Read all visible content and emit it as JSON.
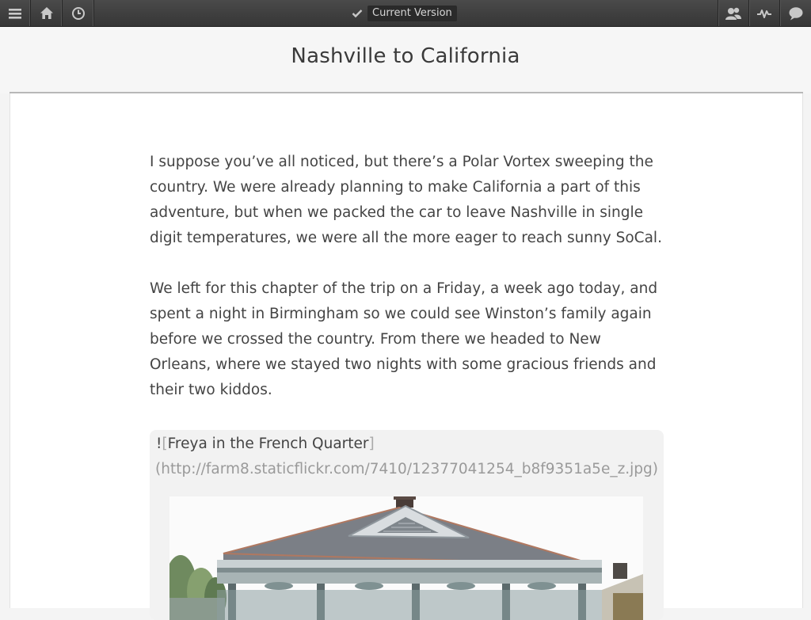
{
  "toolbar": {
    "left_icons": [
      "menu-icon",
      "home-icon",
      "clock-icon"
    ],
    "version_label": "Current Version",
    "right_icons": [
      "people-icon",
      "activity-icon",
      "chat-icon"
    ]
  },
  "document": {
    "title": "Nashville to California",
    "paragraphs": [
      "I suppose you’ve all noticed, but there’s a Polar Vortex sweeping the country. We were already planning to make California a part of this adventure, but when we packed the car to leave Nashville in single digit temperatures, we were all the more eager to reach sunny SoCal.",
      "We left for this chapter of the trip on a Friday, a week ago today, and spent a night in Birmingham so we could see Winston’s family again before we crossed the country. From there we headed to New Orleans, where we stayed two nights with some gracious friends and their two kiddos."
    ],
    "image_markdown": {
      "bang": "!",
      "open_bracket": "[",
      "alt_text": "Freya in the French Quarter",
      "close_bracket": "]",
      "url_line": "(http://farm8.staticflickr.com/7410/12377041254_b8f9351a5e_z.jpg)"
    }
  },
  "colors": {
    "toolbar_bg": "#3d3d3d",
    "icon": "#c8c8c8",
    "title_text": "#3a3a3a",
    "body_text": "#444444",
    "url_text": "#9a9a9a"
  }
}
